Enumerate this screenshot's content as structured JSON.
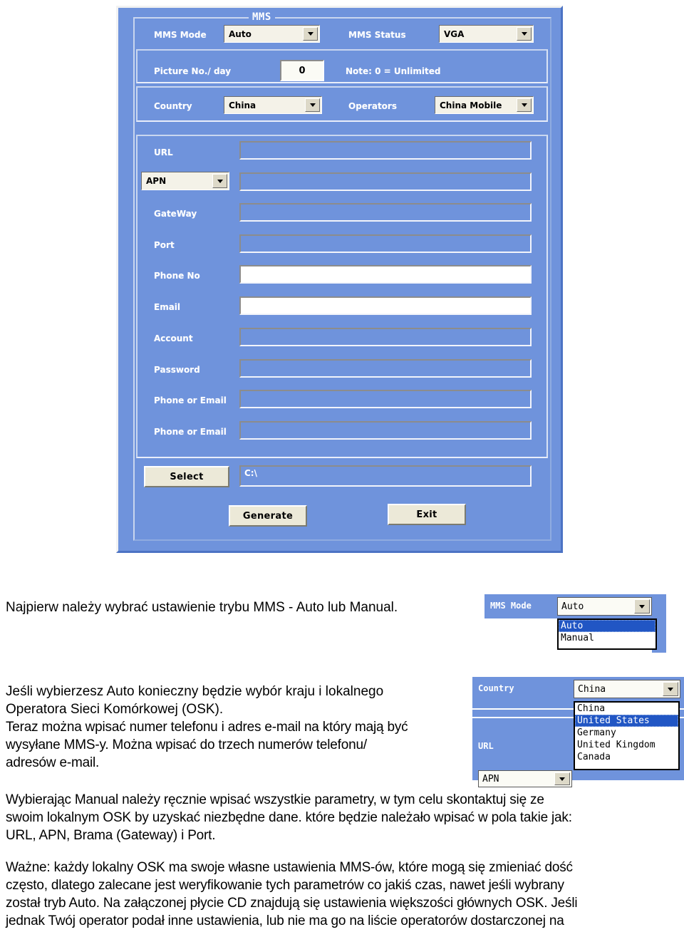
{
  "dialog": {
    "group_legend": "MMS",
    "rows": {
      "mms_mode_label": "MMS Mode",
      "mms_mode_value": "Auto",
      "mms_status_label": "MMS Status",
      "mms_status_value": "VGA",
      "picture_no_label": "Picture No./ day",
      "picture_no_value": "0",
      "note": "Note: 0 = Unlimited",
      "country_label": "Country",
      "country_value": "China",
      "operators_label": "Operators",
      "operators_value": "China Mobile"
    },
    "fields": [
      {
        "label": "URL",
        "value": "",
        "enabled": false
      },
      {
        "label": "APN",
        "value": "",
        "enabled": false,
        "is_combo": true
      },
      {
        "label": "GateWay",
        "value": "",
        "enabled": false
      },
      {
        "label": "Port",
        "value": "",
        "enabled": false
      },
      {
        "label": "Phone No",
        "value": "",
        "enabled": true
      },
      {
        "label": "Email",
        "value": "",
        "enabled": true
      },
      {
        "label": "Account",
        "value": "",
        "enabled": false
      },
      {
        "label": "Password",
        "value": "",
        "enabled": false
      },
      {
        "label": "Phone or Email",
        "value": "",
        "enabled": false
      },
      {
        "label": "Phone or Email",
        "value": "",
        "enabled": false
      }
    ],
    "path_row": {
      "select_button": "Select",
      "path_value": "C:\\"
    },
    "actions": {
      "generate_button": "Generate",
      "exit_button": "Exit"
    }
  },
  "callout_mms_mode": {
    "label": "MMS Mode",
    "selected": "Auto",
    "options": [
      "Auto",
      "Manual"
    ],
    "highlighted": "Auto"
  },
  "callout_country": {
    "label": "Country",
    "selected": "China",
    "options": [
      "China",
      "United States",
      "Germany",
      "United Kingdom",
      "Canada"
    ],
    "highlighted": "United States",
    "url_label": "URL",
    "apn_label": "APN"
  },
  "text": {
    "p1": "Najpierw należy wybrać ustawienie trybu MMS - Auto lub Manual.",
    "p2_l1": "Jeśli wybierzesz Auto konieczny będzie wybór kraju  i lokalnego",
    "p2_l2": "Operatora Sieci Komórkowej (OSK).",
    "p3_l1": "Teraz można wpisać numer telefonu i adres e-mail na który mają być",
    "p3_l2": "wysyłane MMS-y. Można wpisać do trzech numerów telefonu/",
    "p3_l3": "adresów e-mail.",
    "p4_l1": "Wybierając  Manual należy ręcznie wpisać wszystkie parametry, w tym celu skontaktuj się ze",
    "p4_l2": "swoim lokalnym OSK by uzyskać niezbędne dane. które będzie należało wpisać w pola takie jak:",
    "p4_l3": "URL, APN, Brama (Gateway) i Port.",
    "p5_l1": "Ważne: każdy lokalny OSK ma swoje własne ustawienia MMS-ów, które mogą się zmieniać dość",
    "p5_l2": "często, dlatego zalecane jest weryfikowanie tych parametrów co jakiś czas, nawet jeśli wybrany",
    "p5_l3": "został tryb Auto. Na załączonej płycie CD znajdują się ustawienia większości głównych OSK. Jeśli",
    "p5_l4": "jednak Twój operator podał inne ustawienia, lub nie ma go na liście operatorów dostarczonej na"
  },
  "colors": {
    "dialog_blue": "#6f93dc",
    "button_face": "#ece9d8",
    "field_white": "#ffffff",
    "highlight_blue": "#2156c4",
    "label_white": "#ffffff"
  }
}
